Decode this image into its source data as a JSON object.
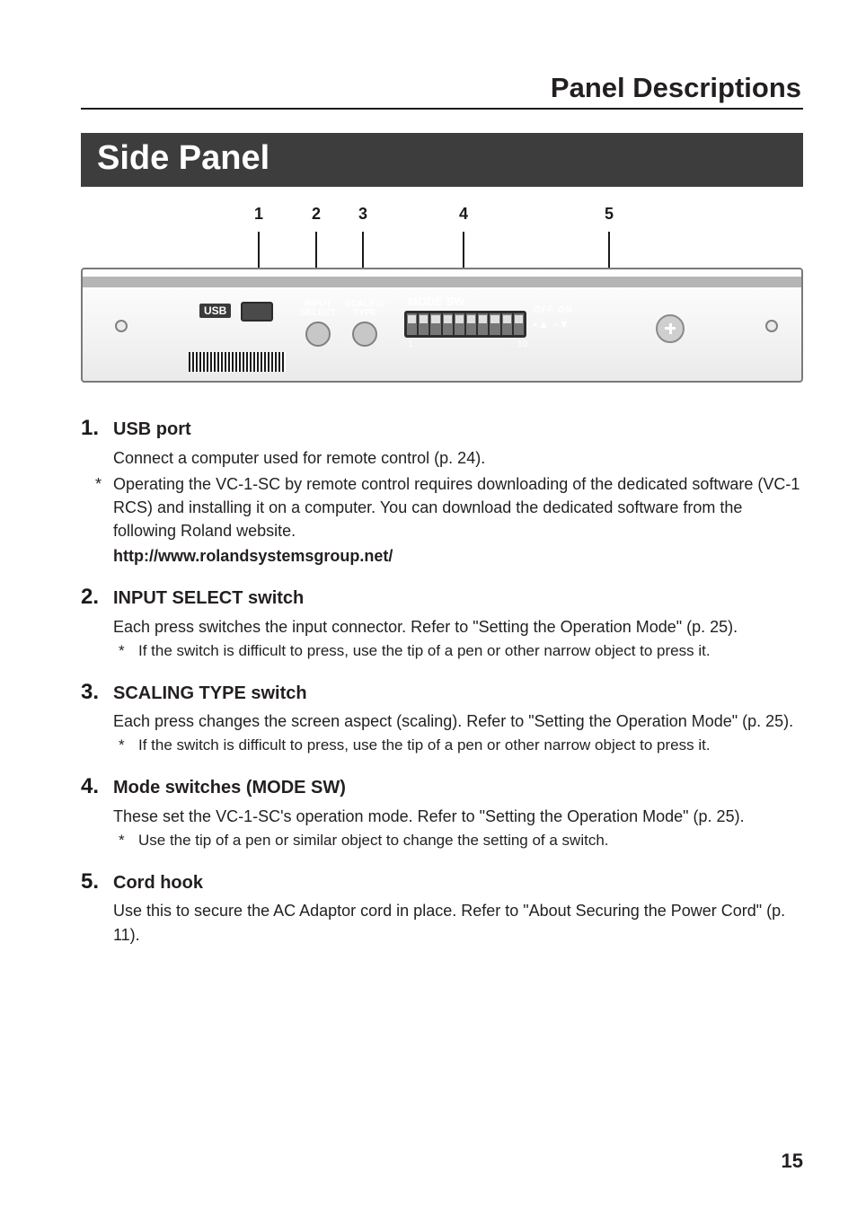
{
  "pageTitle": "Panel Descriptions",
  "sectionTitle": "Side Panel",
  "callouts": [
    "1",
    "2",
    "3",
    "4",
    "5"
  ],
  "diagram": {
    "usbLabel": "USB",
    "inputSelectLabel": "INPUT\nSELECT",
    "scalingTypeLabel": "SCALING\nTYPE",
    "modeSwLabel": "MODE SW",
    "dipStart": "1",
    "dipEnd": "10",
    "offOn": "OFF  ON",
    "offOnIcons": "▪▲ ▫▼"
  },
  "items": [
    {
      "num": "1.",
      "title": "USB port",
      "body": "Connect a computer used for remote control (p. 24).",
      "notes": [
        "Operating the VC-1-SC by remote control requires downloading of the dedicated software (VC-1 RCS) and installing it on a computer. You can download the dedicated software from the following Roland website."
      ],
      "boldLine": "http://www.rolandsystemsgroup.net/"
    },
    {
      "num": "2.",
      "title": "INPUT SELECT switch",
      "body": "Each press switches the input connector. Refer to \"Setting the Operation Mode\" (p. 25).",
      "subnotes": [
        "If the switch is difficult to press, use the tip of a pen or other narrow object to press it."
      ]
    },
    {
      "num": "3.",
      "title": "SCALING TYPE switch",
      "body": "Each press changes the screen aspect (scaling). Refer to \"Setting the Operation Mode\" (p. 25).",
      "subnotes": [
        "If the switch is difficult to press, use the tip of a pen or other narrow object to press it."
      ]
    },
    {
      "num": "4.",
      "title": "Mode switches (MODE SW)",
      "body": "These set the VC-1-SC's operation mode. Refer to \"Setting the Operation Mode\" (p. 25).",
      "subnotes": [
        "Use the tip of a pen or similar object to change the setting of a switch."
      ]
    },
    {
      "num": "5.",
      "title": "Cord hook",
      "body": "Use this to secure the AC Adaptor cord in place. Refer to \"About Securing the Power Cord\" (p. 11)."
    }
  ],
  "pageNumber": "15"
}
